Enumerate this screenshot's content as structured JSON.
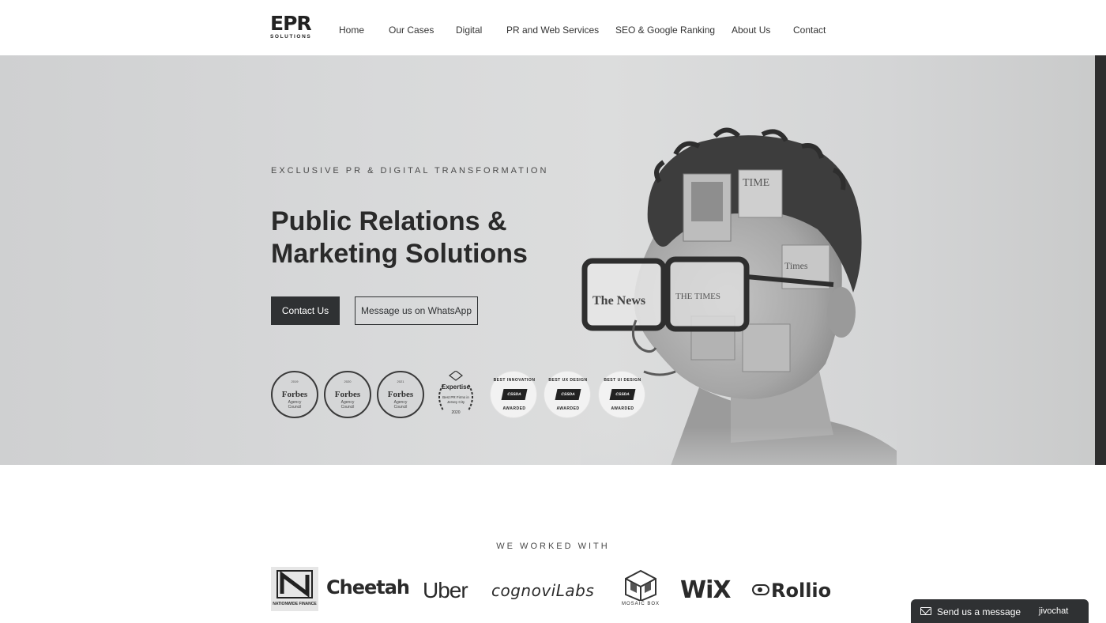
{
  "header": {
    "logo": {
      "mark": "EPR",
      "sub": "SOLUTIONS"
    },
    "nav": [
      "Home",
      "Our Cases",
      "Digital",
      "PR and Web Services",
      "SEO & Google Ranking",
      "About Us",
      "Contact"
    ]
  },
  "hero": {
    "eyebrow": "EXCLUSIVE PR & DIGITAL TRANSFORMATION",
    "headline_line1": "Public Relations &",
    "headline_line2": "Marketing Solutions",
    "contact_button": "Contact Us",
    "whatsapp_button": "Message us on WhatsApp",
    "badges": {
      "forbes": [
        {
          "year": "2019",
          "name": "Forbes",
          "council_line1": "Agency",
          "council_line2": "Council"
        },
        {
          "year": "2020",
          "name": "Forbes",
          "council_line1": "Agency",
          "council_line2": "Council"
        },
        {
          "year": "2021",
          "name": "Forbes",
          "council_line1": "Agency",
          "council_line2": "Council"
        }
      ],
      "expertise": {
        "title": "Expertise",
        "text": "Best PR Firms in Jersey City",
        "year": "2020"
      },
      "cssda": [
        {
          "top": "BEST INNOVATION",
          "mid": "CSSDA",
          "bottom": "AWARDED"
        },
        {
          "top": "BEST UX DESIGN",
          "mid": "CSSDA",
          "bottom": "AWARDED"
        },
        {
          "top": "BEST UI DESIGN",
          "mid": "CSSDA",
          "bottom": "AWARDED"
        }
      ]
    },
    "portrait_texts": {
      "newspaper1": "The News",
      "newspaper2": "THE TIMES",
      "magazine": "TIME",
      "times": "Times"
    }
  },
  "worked_with": {
    "title": "WE WORKED WITH",
    "logos": [
      "NATIONWIDE FINANCE",
      "Cheetah",
      "Uber",
      "cognoviLabs",
      "MOSAIC BOX",
      "WiX",
      "Rollio"
    ]
  },
  "chat": {
    "label": "Send us a message",
    "brand": "jivochat"
  }
}
